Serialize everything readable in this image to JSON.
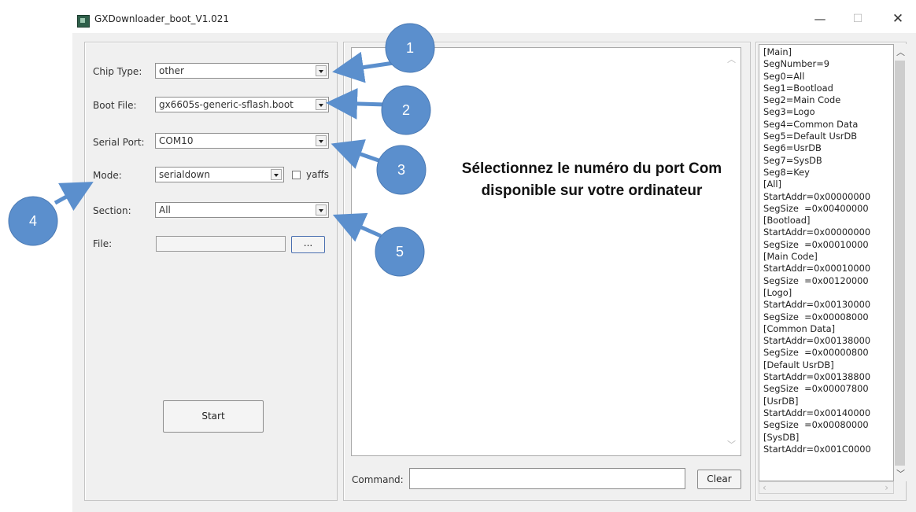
{
  "window": {
    "title": "GXDownloader_boot_V1.021",
    "controls": {
      "minimize": "—",
      "maximize": "☐",
      "close": "✕"
    }
  },
  "form": {
    "chip_type": {
      "label": "Chip Type:",
      "value": "other"
    },
    "boot_file": {
      "label": "Boot File:",
      "value": "gx6605s-generic-sflash.boot"
    },
    "serial_port": {
      "label": "Serial Port:",
      "value": "COM10"
    },
    "mode": {
      "label": "Mode:",
      "value": "serialdown",
      "yaffs_label": "yaffs",
      "yaffs_checked": false
    },
    "section": {
      "label": "Section:",
      "value": "All"
    },
    "file": {
      "label": "File:",
      "value": "",
      "browse_label": "..."
    },
    "start_label": "Start"
  },
  "command": {
    "label": "Command:",
    "value": "",
    "clear_label": "Clear"
  },
  "log_lines": [
    "[Main]",
    "SegNumber=9",
    "Seg0=All",
    "Seg1=Bootload",
    "Seg2=Main Code",
    "Seg3=Logo",
    "Seg4=Common Data",
    "Seg5=Default UsrDB",
    "Seg6=UsrDB",
    "Seg7=SysDB",
    "Seg8=Key",
    "[All]",
    "StartAddr=0x00000000",
    "SegSize  =0x00400000",
    "[Bootload]",
    "StartAddr=0x00000000",
    "SegSize  =0x00010000",
    "[Main Code]",
    "StartAddr=0x00010000",
    "SegSize  =0x00120000",
    "[Logo]",
    "StartAddr=0x00130000",
    "SegSize  =0x00008000",
    "[Common Data]",
    "StartAddr=0x00138000",
    "SegSize  =0x00000800",
    "[Default UsrDB]",
    "StartAddr=0x00138800",
    "SegSize  =0x00007800",
    "[UsrDB]",
    "StartAddr=0x00140000",
    "SegSize  =0x00080000",
    "[SysDB]",
    "StartAddr=0x001C0000"
  ],
  "annotations": {
    "badges": [
      "1",
      "2",
      "3",
      "4",
      "5"
    ],
    "callout": [
      "Sélectionnez le numéro du port Com",
      "disponible sur votre ordinateur"
    ],
    "badge_color": "#5b8fcd",
    "arrow_color": "#5b8fcd"
  }
}
